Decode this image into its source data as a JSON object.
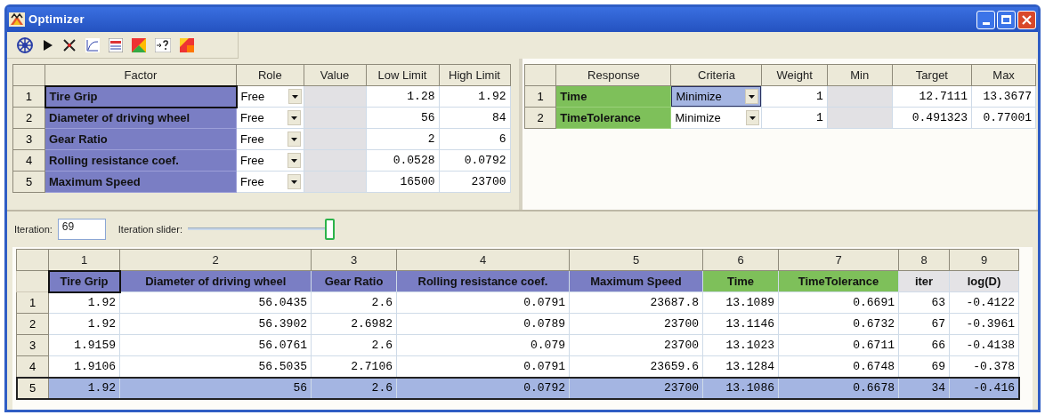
{
  "window": {
    "title": "Optimizer"
  },
  "factor_table": {
    "columns": [
      "Factor",
      "Role",
      "Value",
      "Low Limit",
      "High Limit"
    ],
    "rows": [
      {
        "number": "1",
        "name": "Tire Grip",
        "role": "Free",
        "low": "1.28",
        "high": "1.92",
        "selected": true
      },
      {
        "number": "2",
        "name": "Diameter of driving wheel",
        "role": "Free",
        "low": "56",
        "high": "84",
        "selected": false
      },
      {
        "number": "3",
        "name": "Gear Ratio",
        "role": "Free",
        "low": "2",
        "high": "6",
        "selected": false
      },
      {
        "number": "4",
        "name": "Rolling resistance coef.",
        "role": "Free",
        "low": "0.0528",
        "high": "0.0792",
        "selected": false
      },
      {
        "number": "5",
        "name": "Maximum Speed",
        "role": "Free",
        "low": "16500",
        "high": "23700",
        "selected": false
      }
    ]
  },
  "response_table": {
    "columns": [
      "Response",
      "Criteria",
      "Weight",
      "Min",
      "Target",
      "Max"
    ],
    "rows": [
      {
        "number": "1",
        "name": "Time",
        "criteria": "Minimize",
        "weight": "1",
        "target": "12.7111",
        "max": "13.3677",
        "selected": true
      },
      {
        "number": "2",
        "name": "TimeTolerance",
        "criteria": "Minimize",
        "weight": "1",
        "target": "0.491323",
        "max": "0.77001",
        "selected": false
      }
    ]
  },
  "iteration": {
    "label": "Iteration:",
    "value": "69",
    "slider_label": "Iteration slider:",
    "level": 1
  },
  "results_table": {
    "columns": [
      {
        "number": "1",
        "name": "Tire Grip",
        "kind": "factor",
        "selected": true
      },
      {
        "number": "2",
        "name": "Diameter of driving wheel",
        "kind": "factor",
        "selected": false
      },
      {
        "number": "3",
        "name": "Gear Ratio",
        "kind": "factor",
        "selected": false
      },
      {
        "number": "4",
        "name": "Rolling resistance coef.",
        "kind": "factor",
        "selected": false
      },
      {
        "number": "5",
        "name": "Maximum Speed",
        "kind": "factor",
        "selected": false
      },
      {
        "number": "6",
        "name": "Time",
        "kind": "response",
        "selected": false
      },
      {
        "number": "7",
        "name": "TimeTolerance",
        "kind": "response",
        "selected": false
      },
      {
        "number": "8",
        "name": "iter",
        "kind": "other",
        "selected": false
      },
      {
        "number": "9",
        "name": "log(D)",
        "kind": "other",
        "selected": false
      }
    ],
    "rows": [
      {
        "number": "1",
        "cells": [
          "1.92",
          "56.0435",
          "2.6",
          "0.0791",
          "23687.8",
          "13.1089",
          "0.6691",
          "63",
          "-0.4122"
        ],
        "selected": false
      },
      {
        "number": "2",
        "cells": [
          "1.92",
          "56.3902",
          "2.6982",
          "0.0789",
          "23700",
          "13.1146",
          "0.6732",
          "67",
          "-0.3961"
        ],
        "selected": false
      },
      {
        "number": "3",
        "cells": [
          "1.9159",
          "56.0761",
          "2.6",
          "0.079",
          "23700",
          "13.1023",
          "0.6711",
          "66",
          "-0.4138"
        ],
        "selected": false
      },
      {
        "number": "4",
        "cells": [
          "1.9106",
          "56.5035",
          "2.7106",
          "0.0791",
          "23659.6",
          "13.1284",
          "0.6748",
          "69",
          "-0.378"
        ],
        "selected": false
      },
      {
        "number": "5",
        "cells": [
          "1.92",
          "56",
          "2.6",
          "0.0792",
          "23700",
          "13.1086",
          "0.6678",
          "34",
          "-0.416"
        ],
        "selected": true
      }
    ]
  }
}
